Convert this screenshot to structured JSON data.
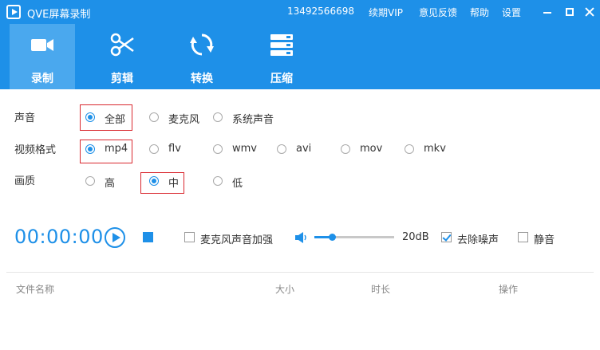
{
  "titlebar": {
    "title": "QVE屏幕录制",
    "phone": "13492566698",
    "vip": "续期VIP",
    "feedback": "意见反馈",
    "help": "帮助",
    "settings": "设置"
  },
  "toolbar": {
    "tabs": [
      {
        "label": "录制",
        "icon": "video-camera-icon",
        "active": true
      },
      {
        "label": "剪辑",
        "icon": "scissors-icon",
        "active": false
      },
      {
        "label": "转换",
        "icon": "refresh-icon",
        "active": false
      },
      {
        "label": "压缩",
        "icon": "stack-icon",
        "active": false
      }
    ]
  },
  "settings": {
    "sound": {
      "label": "声音",
      "options": [
        "全部",
        "麦克风",
        "系统声音"
      ],
      "selected": "全部"
    },
    "format": {
      "label": "视频格式",
      "options": [
        "mp4",
        "flv",
        "wmv",
        "avi",
        "mov",
        "mkv"
      ],
      "selected": "mp4"
    },
    "quality": {
      "label": "画质",
      "options": [
        "高",
        "中",
        "低"
      ],
      "selected": "中"
    }
  },
  "controls": {
    "timer": "00:00:00",
    "mic_boost": {
      "label": "麦克风声音加强",
      "checked": false
    },
    "volume": {
      "value": "20dB",
      "level": 0.22
    },
    "denoise": {
      "label": "去除噪声",
      "checked": true
    },
    "mute": {
      "label": "静音",
      "checked": false
    }
  },
  "filelist": {
    "columns": [
      "文件名称",
      "大小",
      "时长",
      "操作"
    ]
  },
  "colors": {
    "accent": "#1e90e8",
    "highlight": "#d9282f"
  }
}
